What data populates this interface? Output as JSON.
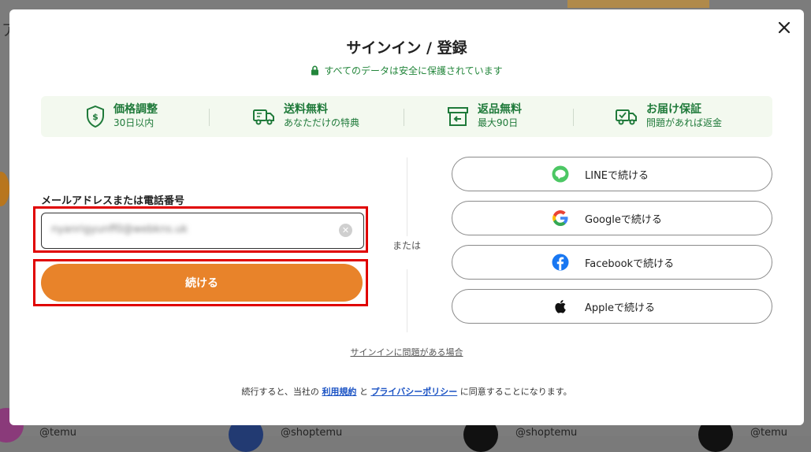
{
  "background": {
    "left_texts": [
      "ア"
    ],
    "handles": [
      "@temu",
      "@shoptemu",
      "@shoptemu",
      "@temu"
    ]
  },
  "modal": {
    "close_icon": "close-icon",
    "title": "サインイン / 登録",
    "secure_text": "すべてのデータは安全に保護されています",
    "benefits": [
      {
        "icon": "price-shield-icon",
        "title": "価格調整",
        "sub": "30日以内"
      },
      {
        "icon": "truck-icon",
        "title": "送料無料",
        "sub": "あなただけの特典"
      },
      {
        "icon": "return-box-icon",
        "title": "返品無料",
        "sub": "最大90日"
      },
      {
        "icon": "delivery-check-icon",
        "title": "お届け保証",
        "sub": "問題があれば返金"
      }
    ],
    "email": {
      "label": "メールアドレスまたは電話番号",
      "value": "nyanrigyunff0@webkns.uk"
    },
    "continue_label": "続ける",
    "or_text": "または",
    "social": [
      {
        "icon": "line-icon",
        "label": "LINEで続ける"
      },
      {
        "icon": "google-icon",
        "label": "Googleで続ける"
      },
      {
        "icon": "facebook-icon",
        "label": "Facebookで続ける"
      },
      {
        "icon": "apple-icon",
        "label": "Appleで続ける"
      }
    ],
    "trouble_link": "サインインに問題がある場合",
    "terms": {
      "prefix": "続行すると、当社の",
      "terms_link": "利用規約",
      "and": "と",
      "privacy_link": "プライバシーポリシー",
      "suffix": "に同意することになります。"
    }
  },
  "colors": {
    "accent": "#e8832a",
    "green": "#1f7a3a",
    "highlight": "#e00000",
    "link": "#1b53c4"
  }
}
